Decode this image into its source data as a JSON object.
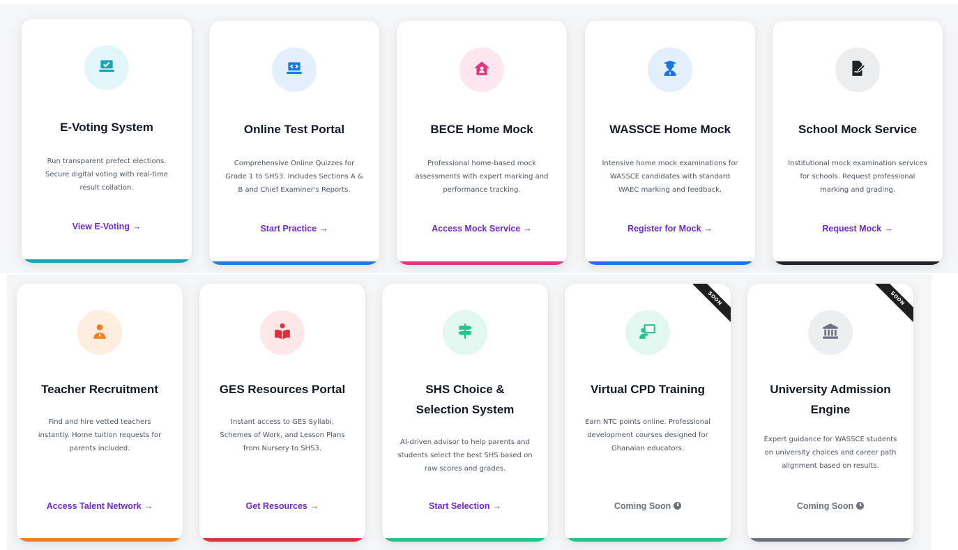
{
  "row1": [
    {
      "title": "E-Voting System",
      "desc": "Run transparent prefect elections. Secure digital voting with real-time result collation.",
      "link": "View E-Voting",
      "icon": "laptop-check-icon",
      "accent": "#1ba3b8",
      "icon_bg": "#e2f5f8"
    },
    {
      "title": "Online Test Portal",
      "desc": "Comprehensive Online Quizzes for Grade 1 to SHS3. Includes Sections A & B and Chief Examiner's Reports.",
      "link": "Start Practice",
      "icon": "laptop-code-icon",
      "accent": "#1a7be0",
      "icon_bg": "#e3effd"
    },
    {
      "title": "BECE Home Mock",
      "desc": "Professional home-based mock assessments with expert marking and performance tracking.",
      "link": "Access Mock Service",
      "icon": "home-user-icon",
      "accent": "#e0357f",
      "icon_bg": "#fde6f0"
    },
    {
      "title": "WASSCE Home Mock",
      "desc": "Intensive home mock examinations for WASSCE candidates with standard WAEC marking and feedback.",
      "link": "Register for Mock",
      "icon": "graduate-icon",
      "accent": "#1a73e8",
      "icon_bg": "#e3effd"
    },
    {
      "title": "School Mock Service",
      "desc": "Institutional mock examination services for schools. Request professional marking and grading.",
      "link": "Request Mock",
      "icon": "file-signature-icon",
      "accent": "#1f2328",
      "icon_bg": "#ebedef"
    }
  ],
  "row2": [
    {
      "title": "Teacher Recruitment",
      "desc": "Find and hire vetted teachers instantly. Home tuition requests for parents included.",
      "link": "Access Talent Network",
      "icon": "teacher-icon",
      "accent": "#f27e1c",
      "icon_bg": "#fdeedf"
    },
    {
      "title": "GES Resources Portal",
      "desc": "Instant access to GES Syllabi, Schemes of Work, and Lesson Plans from Nursery to SHS3.",
      "link": "Get Resources",
      "icon": "book-reader-icon",
      "accent": "#e0303d",
      "icon_bg": "#fde7e8"
    },
    {
      "title": "SHS Choice & Selection System",
      "desc": "AI-driven advisor to help parents and students select the best SHS based on raw scores and grades.",
      "link": "Start Selection",
      "icon": "signpost-icon",
      "accent": "#22c38e",
      "icon_bg": "#e1f7ef"
    },
    {
      "title": "Virtual CPD Training",
      "desc": "Earn NTC points online. Professional development courses designed for Ghanaian educators.",
      "link": "Coming Soon",
      "icon": "chalkboard-teacher-icon",
      "accent": "#22c38e",
      "icon_bg": "#e1f7ef",
      "ribbon": "SOON"
    },
    {
      "title": "University Admission Engine",
      "desc": "Expert guidance for WASSCE students on university choices and career path alignment based on results.",
      "link": "Coming Soon",
      "icon": "university-icon",
      "accent": "#6b7280",
      "icon_bg": "#eceef0",
      "ribbon": "SOON"
    }
  ]
}
